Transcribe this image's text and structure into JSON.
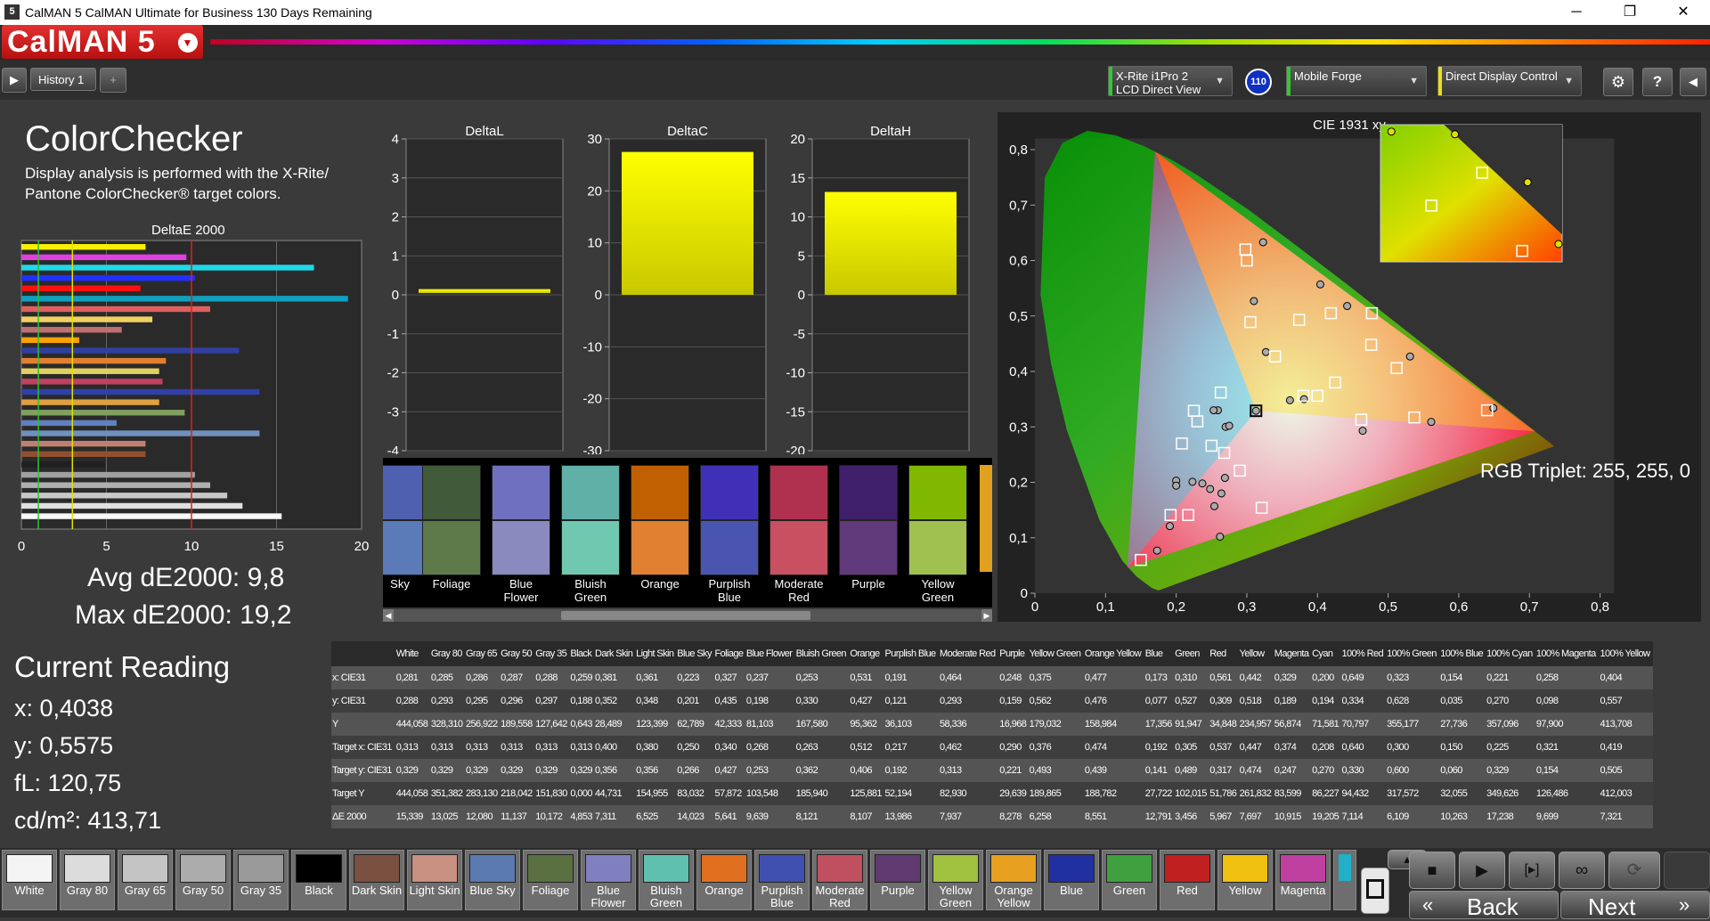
{
  "titlebar": {
    "title": "CalMAN 5 CalMAN Ultimate for Business 130 Days Remaining",
    "icon_text": "5",
    "min": "─",
    "max": "❐",
    "close": "✕"
  },
  "brand": {
    "logo": "CalMAN 5"
  },
  "toolbar": {
    "history_tab": "History 1",
    "add_tab": "+",
    "meter": {
      "line1": "X-Rite i1Pro 2",
      "line2": "LCD Direct View",
      "color": "#2ecc2e"
    },
    "badge": "110",
    "source": {
      "line1": "Mobile Forge",
      "color": "#2ecc2e"
    },
    "display": {
      "line1": "Direct Display Control",
      "color": "#e8e020"
    }
  },
  "info": {
    "title": "ColorChecker",
    "desc1": "Display analysis is performed with the X-Rite/",
    "desc2": "Pantone ColorChecker® target colors.",
    "de_title": "DeltaE 2000",
    "avg": "Avg dE2000: 9,8",
    "max": "Max dE2000: 19,2",
    "current_title": "Current Reading",
    "x": "x: 0,4038",
    "y": "y: 0,5575",
    "fl": "fL: 120,75",
    "cdm": "cd/m²: 413,71"
  },
  "de_chart": {
    "xticks": [
      "0",
      "5",
      "10",
      "15",
      "20"
    ],
    "thresholds": [
      1,
      3,
      10
    ],
    "xmax": 20,
    "bars": [
      {
        "v": 7.3,
        "c": "#f8f000"
      },
      {
        "v": 9.7,
        "c": "#e040e0"
      },
      {
        "v": 17.2,
        "c": "#20d8e8"
      },
      {
        "v": 10.2,
        "c": "#2030ff"
      },
      {
        "v": 7.0,
        "c": "#ff1010"
      },
      {
        "v": 19.2,
        "c": "#10a0c0"
      },
      {
        "v": 11.1,
        "c": "#e06060"
      },
      {
        "v": 7.7,
        "c": "#f0d060"
      },
      {
        "v": 5.9,
        "c": "#c07070"
      },
      {
        "v": 3.4,
        "c": "#ffa000"
      },
      {
        "v": 12.8,
        "c": "#3040a0"
      },
      {
        "v": 8.5,
        "c": "#e08030"
      },
      {
        "v": 8.1,
        "c": "#e0d060"
      },
      {
        "v": 8.3,
        "c": "#c04060"
      },
      {
        "v": 14.0,
        "c": "#3040a8"
      },
      {
        "v": 8.1,
        "c": "#e0a040"
      },
      {
        "v": 9.6,
        "c": "#80a060"
      },
      {
        "v": 5.6,
        "c": "#6080c0"
      },
      {
        "v": 14.0,
        "c": "#7090c0"
      },
      {
        "v": 7.3,
        "c": "#c08070"
      },
      {
        "v": 7.3,
        "c": "#905030"
      },
      {
        "v": 4.9,
        "c": "#202020"
      },
      {
        "v": 10.2,
        "c": "#a0a0a0"
      },
      {
        "v": 11.1,
        "c": "#b0b0b0"
      },
      {
        "v": 12.1,
        "c": "#c8c8c8"
      },
      {
        "v": 13.0,
        "c": "#e0e0e0"
      },
      {
        "v": 15.3,
        "c": "#f8f8f8"
      }
    ]
  },
  "delta_charts": [
    {
      "title": "DeltaL",
      "ticks": [
        "4",
        "3",
        "2",
        "1",
        "0",
        "-1",
        "-2",
        "-3",
        "-4"
      ],
      "min": -4,
      "max": 4,
      "value": 0.1
    },
    {
      "title": "DeltaC",
      "ticks": [
        "30",
        "20",
        "10",
        "0",
        "-10",
        "-20",
        "-30"
      ],
      "min": -30,
      "max": 30,
      "value": 27.5
    },
    {
      "title": "DeltaH",
      "ticks": [
        "20",
        "15",
        "10",
        "5",
        "0",
        "-5",
        "-10",
        "-15",
        "-20"
      ],
      "min": -20,
      "max": 20,
      "value": 13.2
    }
  ],
  "swatch_strip": [
    {
      "name": "Sky",
      "top": "#5060b0",
      "bot": "#5a7ab8"
    },
    {
      "name": "Foliage",
      "top": "#405a3a",
      "bot": "#5e7a4a"
    },
    {
      "name": "Blue Flower",
      "top": "#7070c0",
      "bot": "#8a8abf"
    },
    {
      "name": "Bluish Green",
      "top": "#60b0a8",
      "bot": "#70c8b0"
    },
    {
      "name": "Orange",
      "top": "#c06000",
      "bot": "#e08030"
    },
    {
      "name": "Purplish Blue",
      "top": "#4030b8",
      "bot": "#4a55b0"
    },
    {
      "name": "Moderate Red",
      "top": "#b03050",
      "bot": "#c85060"
    },
    {
      "name": "Purple",
      "top": "#40206a",
      "bot": "#603a7a"
    },
    {
      "name": "Yellow Green",
      "top": "#80b800",
      "bot": "#a0c050"
    }
  ],
  "cie": {
    "title": "CIE 1931 xy",
    "xticks": [
      "0",
      "0,1",
      "0,2",
      "0,3",
      "0,4",
      "0,5",
      "0,6",
      "0,7",
      "0,8"
    ],
    "yticks": [
      "0,8",
      "0,7",
      "0,6",
      "0,5",
      "0,4",
      "0,3",
      "0,2",
      "0,1",
      "0"
    ],
    "triplet": "RGB Triplet: 255, 255, 0",
    "gamut": {
      "r": [
        0.708,
        0.292
      ],
      "g": [
        0.17,
        0.797
      ],
      "b": [
        0.131,
        0.046
      ]
    },
    "targets": [
      [
        0.305,
        0.489
      ],
      [
        0.298,
        0.62
      ],
      [
        0.313,
        0.329
      ],
      [
        0.374,
        0.493
      ],
      [
        0.419,
        0.505
      ],
      [
        0.537,
        0.317
      ],
      [
        0.462,
        0.313
      ],
      [
        0.4,
        0.356
      ],
      [
        0.38,
        0.356
      ],
      [
        0.25,
        0.266
      ],
      [
        0.34,
        0.427
      ],
      [
        0.268,
        0.253
      ],
      [
        0.263,
        0.362
      ],
      [
        0.217,
        0.141
      ],
      [
        0.192,
        0.141
      ],
      [
        0.15,
        0.06
      ],
      [
        0.225,
        0.329
      ],
      [
        0.29,
        0.221
      ],
      [
        0.512,
        0.406
      ],
      [
        0.64,
        0.33
      ],
      [
        0.3,
        0.6
      ],
      [
        0.208,
        0.27
      ],
      [
        0.321,
        0.154
      ],
      [
        0.477,
        0.505
      ],
      [
        0.476,
        0.448
      ],
      [
        0.425,
        0.38
      ],
      [
        0.23,
        0.31
      ]
    ],
    "measured": [
      [
        0.323,
        0.633
      ],
      [
        0.31,
        0.527
      ],
      [
        0.313,
        0.329
      ],
      [
        0.442,
        0.518
      ],
      [
        0.404,
        0.557
      ],
      [
        0.561,
        0.309
      ],
      [
        0.464,
        0.293
      ],
      [
        0.381,
        0.35
      ],
      [
        0.361,
        0.348
      ],
      [
        0.259,
        0.33
      ],
      [
        0.327,
        0.435
      ],
      [
        0.237,
        0.198
      ],
      [
        0.253,
        0.33
      ],
      [
        0.191,
        0.121
      ],
      [
        0.2,
        0.203
      ],
      [
        0.173,
        0.077
      ],
      [
        0.223,
        0.201
      ],
      [
        0.248,
        0.188
      ],
      [
        0.531,
        0.427
      ],
      [
        0.649,
        0.334
      ],
      [
        0.269,
        0.208
      ],
      [
        0.2,
        0.194
      ],
      [
        0.254,
        0.157
      ],
      [
        0.264,
        0.18
      ],
      [
        0.27,
        0.3
      ],
      [
        0.275,
        0.302
      ],
      [
        0.262,
        0.102
      ]
    ],
    "zoom_targets": [
      [
        0.56,
        0.35
      ],
      [
        0.28,
        0.59
      ],
      [
        0.78,
        0.92
      ]
    ],
    "zoom_measured": [
      [
        0.06,
        0.05
      ],
      [
        0.41,
        0.07
      ],
      [
        0.81,
        0.42
      ],
      [
        0.98,
        0.87
      ]
    ]
  },
  "table": {
    "headers": [
      "",
      "White",
      "Gray 80",
      "Gray 65",
      "Gray 50",
      "Gray 35",
      "Black",
      "Dark Skin",
      "Light Skin",
      "Blue Sky",
      "Foliage",
      "Blue Flower",
      "Bluish Green",
      "Orange",
      "Purplish Blue",
      "Moderate Red",
      "Purple",
      "Yellow Green",
      "Orange Yellow",
      "Blue",
      "Green",
      "Red",
      "Yellow",
      "Magenta",
      "Cyan",
      "100% Red",
      "100% Green",
      "100% Blue",
      "100% Cyan",
      "100% Magenta",
      "100% Yellow"
    ],
    "rows": [
      [
        "x: CIE31",
        "0,281",
        "0,285",
        "0,286",
        "0,287",
        "0,288",
        "0,259",
        "0,381",
        "0,361",
        "0,223",
        "0,327",
        "0,237",
        "0,253",
        "0,531",
        "0,191",
        "0,464",
        "0,248",
        "0,375",
        "0,477",
        "0,173",
        "0,310",
        "0,561",
        "0,442",
        "0,329",
        "0,200",
        "0,649",
        "0,323",
        "0,154",
        "0,221",
        "0,258",
        "0,404"
      ],
      [
        "y: CIE31",
        "0,288",
        "0,293",
        "0,295",
        "0,296",
        "0,297",
        "0,188",
        "0,352",
        "0,348",
        "0,201",
        "0,435",
        "0,198",
        "0,330",
        "0,427",
        "0,121",
        "0,293",
        "0,159",
        "0,562",
        "0,476",
        "0,077",
        "0,527",
        "0,309",
        "0,518",
        "0,189",
        "0,194",
        "0,334",
        "0,628",
        "0,035",
        "0,270",
        "0,098",
        "0,557"
      ],
      [
        "Y",
        "444,058",
        "328,310",
        "256,922",
        "189,558",
        "127,642",
        "0,643",
        "28,489",
        "123,399",
        "62,789",
        "42,333",
        "81,103",
        "167,580",
        "95,362",
        "36,103",
        "58,336",
        "16,968",
        "179,032",
        "158,984",
        "17,356",
        "91,947",
        "34,848",
        "234,957",
        "56,874",
        "71,581",
        "70,797",
        "355,177",
        "27,736",
        "357,096",
        "97,900",
        "413,708"
      ],
      [
        "Target x: CIE31",
        "0,313",
        "0,313",
        "0,313",
        "0,313",
        "0,313",
        "0,313",
        "0,400",
        "0,380",
        "0,250",
        "0,340",
        "0,268",
        "0,263",
        "0,512",
        "0,217",
        "0,462",
        "0,290",
        "0,376",
        "0,474",
        "0,192",
        "0,305",
        "0,537",
        "0,447",
        "0,374",
        "0,208",
        "0,640",
        "0,300",
        "0,150",
        "0,225",
        "0,321",
        "0,419"
      ],
      [
        "Target y: CIE31",
        "0,329",
        "0,329",
        "0,329",
        "0,329",
        "0,329",
        "0,329",
        "0,356",
        "0,356",
        "0,266",
        "0,427",
        "0,253",
        "0,362",
        "0,406",
        "0,192",
        "0,313",
        "0,221",
        "0,493",
        "0,439",
        "0,141",
        "0,489",
        "0,317",
        "0,474",
        "0,247",
        "0,270",
        "0,330",
        "0,600",
        "0,060",
        "0,329",
        "0,154",
        "0,505"
      ],
      [
        "Target Y",
        "444,058",
        "351,382",
        "283,130",
        "218,042",
        "151,830",
        "0,000",
        "44,731",
        "154,955",
        "83,032",
        "57,872",
        "103,548",
        "185,940",
        "125,881",
        "52,194",
        "82,930",
        "29,639",
        "189,865",
        "188,782",
        "27,722",
        "102,015",
        "51,786",
        "261,832",
        "83,599",
        "86,227",
        "94,432",
        "317,572",
        "32,055",
        "349,626",
        "126,486",
        "412,003"
      ],
      [
        "ΔE 2000",
        "15,339",
        "13,025",
        "12,080",
        "11,137",
        "10,172",
        "4,853",
        "7,311",
        "6,525",
        "14,023",
        "5,641",
        "9,639",
        "8,121",
        "8,107",
        "13,986",
        "7,937",
        "8,278",
        "6,258",
        "8,551",
        "12,791",
        "3,456",
        "5,967",
        "7,697",
        "10,915",
        "19,205",
        "7,114",
        "6,109",
        "10,263",
        "17,238",
        "9,699",
        "7,321"
      ]
    ]
  },
  "bottom_swatches": [
    {
      "name": "White",
      "c": "#f4f4f4"
    },
    {
      "name": "Gray 80",
      "c": "#dcdcdc"
    },
    {
      "name": "Gray 65",
      "c": "#c4c4c4"
    },
    {
      "name": "Gray 50",
      "c": "#acacac"
    },
    {
      "name": "Gray 35",
      "c": "#9a9a9a"
    },
    {
      "name": "Black",
      "c": "#000000"
    },
    {
      "name": "Dark Skin",
      "c": "#7a5040"
    },
    {
      "name": "Light Skin",
      "c": "#c89080"
    },
    {
      "name": "Blue Sky",
      "c": "#5a7ab0"
    },
    {
      "name": "Foliage",
      "c": "#5a7040"
    },
    {
      "name": "Blue Flower",
      "c": "#8080c0"
    },
    {
      "name": "Bluish Green",
      "c": "#60c0b0"
    },
    {
      "name": "Orange",
      "c": "#e07020"
    },
    {
      "name": "Purplish Blue",
      "c": "#4050b0"
    },
    {
      "name": "Moderate Red",
      "c": "#c05060"
    },
    {
      "name": "Purple",
      "c": "#603a70"
    },
    {
      "name": "Yellow Green",
      "c": "#a0c040"
    },
    {
      "name": "Orange Yellow",
      "c": "#e8a020"
    },
    {
      "name": "Blue",
      "c": "#2030a0"
    },
    {
      "name": "Green",
      "c": "#40a040"
    },
    {
      "name": "Red",
      "c": "#c02020"
    },
    {
      "name": "Yellow",
      "c": "#f0c010"
    },
    {
      "name": "Magenta",
      "c": "#c040a0"
    }
  ],
  "nav": {
    "back": "Back",
    "next": "Next",
    "back_icon": "«",
    "next_icon": "»"
  }
}
